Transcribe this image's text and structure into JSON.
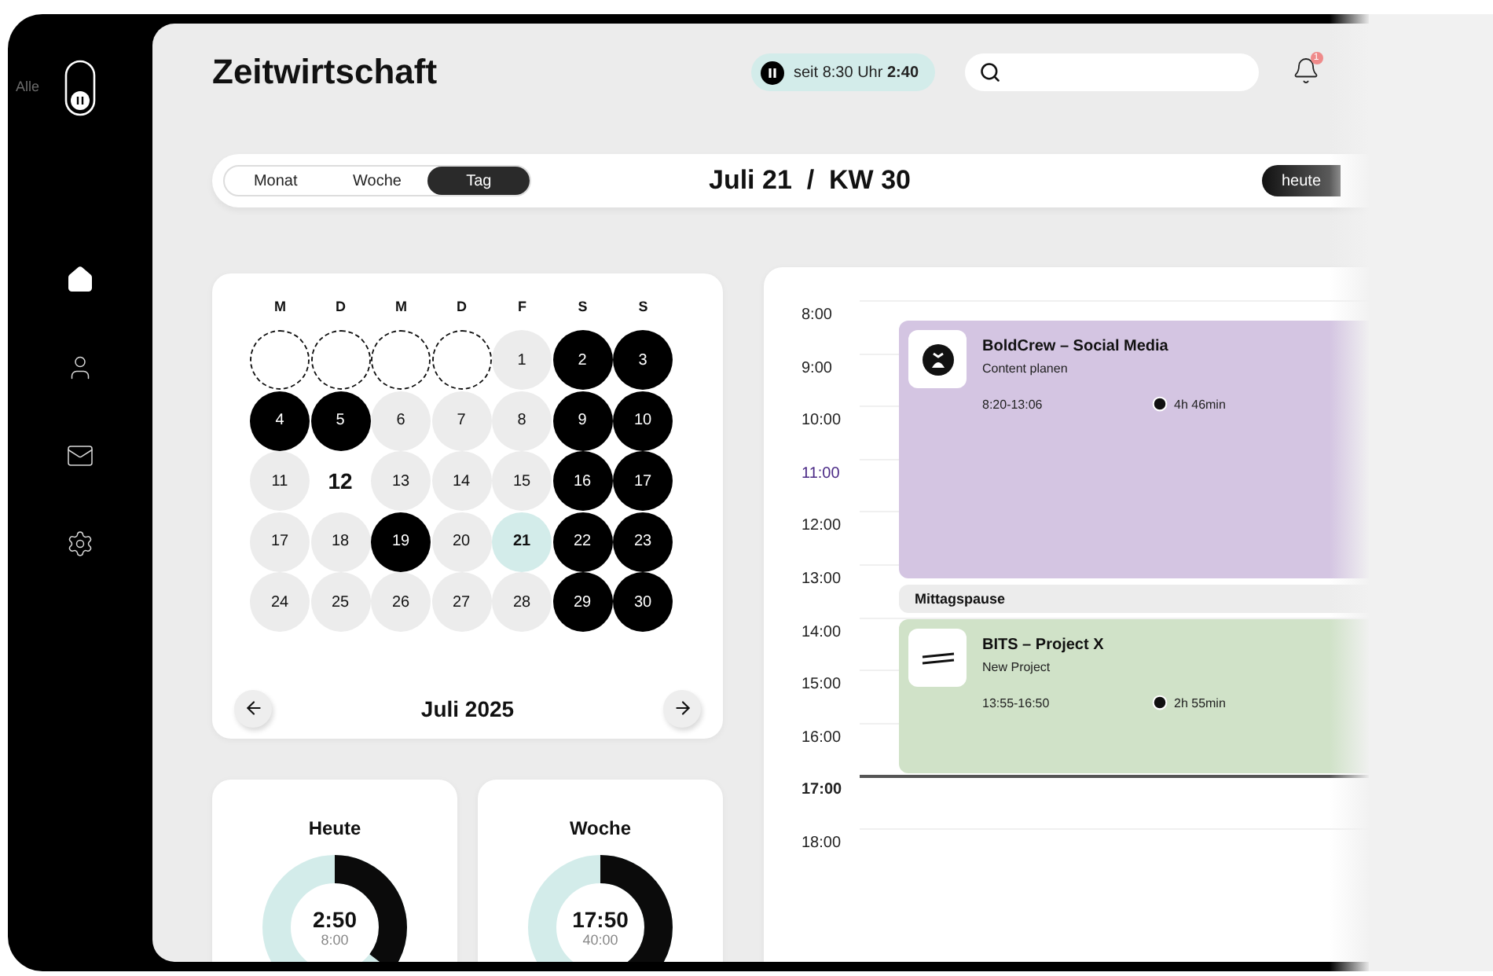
{
  "sidebar": {
    "label": "Alle",
    "items": [
      {
        "selected": true
      },
      {
        "selected": false
      },
      {
        "selected": false
      },
      {
        "selected": false
      }
    ]
  },
  "header": {
    "title": "Zeitwirtschaft",
    "timer": "seit 8:30 Uhr **2:40**",
    "notifications": "1"
  },
  "toolbar": {
    "views": [
      {
        "label": "Monat",
        "selected": false
      },
      {
        "label": "Woche",
        "selected": false
      },
      {
        "label": "Tag",
        "selected": true
      }
    ],
    "date": "Juli 21  /  KW 30",
    "today_button": "heute"
  },
  "calendar": {
    "weekdays": [
      "M",
      "D",
      "M",
      "D",
      "F",
      "S",
      "S"
    ],
    "days": [
      {
        "kind": "blank"
      },
      {
        "kind": "blank"
      },
      {
        "kind": "blank"
      },
      {
        "kind": "blank"
      },
      {
        "label": "1",
        "kind": "work"
      },
      {
        "label": "2",
        "kind": "off"
      },
      {
        "label": "3",
        "kind": "off"
      },
      {
        "label": "4",
        "kind": "off"
      },
      {
        "label": "5",
        "kind": "off"
      },
      {
        "label": "6",
        "kind": "work"
      },
      {
        "label": "7",
        "kind": "work"
      },
      {
        "label": "8",
        "kind": "work"
      },
      {
        "label": "9",
        "kind": "off"
      },
      {
        "label": "10",
        "kind": "off"
      },
      {
        "label": "11",
        "kind": "work"
      },
      {
        "label": "12",
        "kind": "plain"
      },
      {
        "label": "13",
        "kind": "work"
      },
      {
        "label": "14",
        "kind": "work"
      },
      {
        "label": "15",
        "kind": "work"
      },
      {
        "label": "16",
        "kind": "off"
      },
      {
        "label": "17",
        "kind": "off"
      },
      {
        "label": "17",
        "kind": "work"
      },
      {
        "label": "18",
        "kind": "work"
      },
      {
        "label": "19",
        "kind": "off"
      },
      {
        "label": "20",
        "kind": "work"
      },
      {
        "label": "21",
        "kind": "today"
      },
      {
        "label": "22",
        "kind": "off"
      },
      {
        "label": "23",
        "kind": "off"
      },
      {
        "label": "24",
        "kind": "work"
      },
      {
        "label": "25",
        "kind": "work"
      },
      {
        "label": "26",
        "kind": "work"
      },
      {
        "label": "27",
        "kind": "work"
      },
      {
        "label": "28",
        "kind": "work"
      },
      {
        "label": "29",
        "kind": "off"
      },
      {
        "label": "30",
        "kind": "off"
      }
    ],
    "month": "Juli 2025"
  },
  "stats": [
    {
      "title": "Heute",
      "value": "2:50",
      "target": "8:00"
    },
    {
      "title": "Woche",
      "value": "17:50",
      "target": "40:00"
    }
  ],
  "timeline": {
    "hours": [
      {
        "label": "8:00",
        "kind": "normal"
      },
      {
        "label": "9:00",
        "kind": "normal"
      },
      {
        "label": "10:00",
        "kind": "normal"
      },
      {
        "label": "11:00",
        "kind": "highlighted"
      },
      {
        "label": "12:00",
        "kind": "normal"
      },
      {
        "label": "13:00",
        "kind": "normal"
      },
      {
        "label": "14:00",
        "kind": "normal"
      },
      {
        "label": "15:00",
        "kind": "normal"
      },
      {
        "label": "16:00",
        "kind": "normal"
      },
      {
        "label": "17:00",
        "kind": "current"
      },
      {
        "label": "18:00",
        "kind": "normal"
      }
    ],
    "entries": [
      {
        "kind": "project",
        "title": "BoldCrew – Social Media",
        "subtitle": "Content planen",
        "time": "8:20-13:06",
        "duration": "4h 46min",
        "color": "#d4c5e2"
      },
      {
        "kind": "break",
        "title": "Mittagspause",
        "color": "#ececec"
      },
      {
        "kind": "project",
        "title": "BITS – Project X",
        "subtitle": "New Project",
        "time": "13:55-16:50",
        "duration": "2h 55min",
        "color": "#d0e2c8"
      }
    ]
  }
}
